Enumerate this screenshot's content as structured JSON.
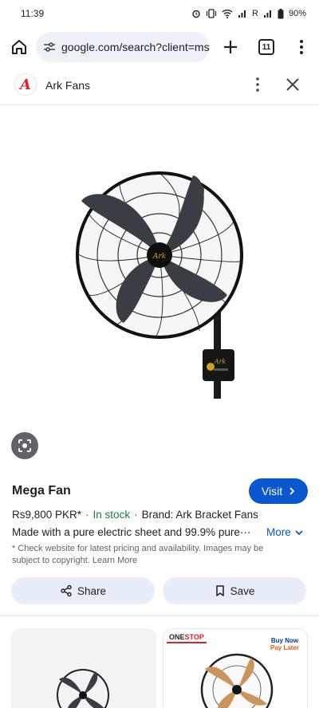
{
  "status_bar": {
    "time": "11:39",
    "signal_text": "R",
    "battery": "90%"
  },
  "browser": {
    "url": "google.com/search?client=ms-a",
    "tab_count": "11"
  },
  "panel": {
    "site_name": "Ark Fans",
    "logo_letter": "A"
  },
  "product": {
    "title": "Mega Fan",
    "visit_label": "Visit",
    "price": "Rs9,800 PKR*",
    "stock": "In stock",
    "brand": "Brand: Ark Bracket Fans",
    "description": "Made with a pure electric sheet and 99.9% pure···",
    "more_label": "More",
    "disclaimer": "* Check website for latest pricing and availability. Images may be subject to copyright. Learn More",
    "share_label": "Share",
    "save_label": "Save",
    "fan_brand_mark": "Ark"
  },
  "related": {
    "badge_one": "ONE",
    "badge_stop": "STOP",
    "buy_now": "Buy Now",
    "pay_later": "Pay Later"
  },
  "colors": {
    "accent": "#0b57d0",
    "in_stock": "#188038",
    "brand_red": "#d9232d"
  },
  "icons": [
    "home-icon",
    "tune-icon",
    "plus-icon",
    "tabs-icon",
    "kebab-icon",
    "close-icon",
    "lens-icon",
    "chevron-right-icon",
    "chevron-down-icon",
    "share-icon",
    "bookmark-icon"
  ]
}
